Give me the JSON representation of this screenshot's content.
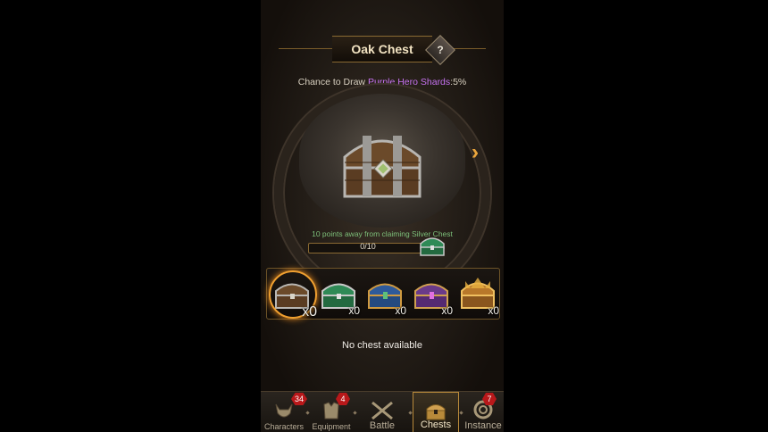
{
  "header": {
    "title": "Oak Chest",
    "help_glyph": "?"
  },
  "chance": {
    "prefix": "Chance to Draw ",
    "item": "Purple Hero Shards",
    "suffix": ":5%"
  },
  "progress": {
    "message": "10 points away from claiming Silver Chest",
    "label": "0/10",
    "value": 0,
    "max": 10
  },
  "chest_slots": [
    {
      "name": "oak",
      "count": "x0",
      "selected": true
    },
    {
      "name": "silver",
      "count": "x0",
      "selected": false
    },
    {
      "name": "blue",
      "count": "x0",
      "selected": false
    },
    {
      "name": "purple",
      "count": "x0",
      "selected": false
    },
    {
      "name": "gold",
      "count": "x0",
      "selected": false
    }
  ],
  "empty_message": "No chest available",
  "nav": {
    "characters": {
      "label": "Characters",
      "badge": "34"
    },
    "equipment": {
      "label": "Equipment",
      "badge": "4"
    },
    "battle": {
      "label": "Battle"
    },
    "chests": {
      "label": "Chests"
    },
    "instance": {
      "label": "Instance",
      "badge": "7"
    }
  },
  "colors": {
    "accent_gold": "#e9a53c",
    "purple_text": "#c672f0",
    "progress_green": "#7dc07a",
    "badge_red": "#b8181a"
  }
}
